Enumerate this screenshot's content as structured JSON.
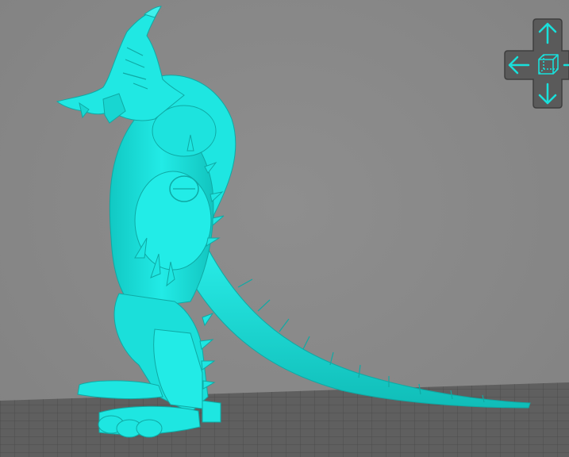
{
  "viewport": {
    "background_color": "#878787",
    "model_color": "#19e0db",
    "model_shadow_color": "#0fb5b0",
    "model_highlight_color": "#6ff5f1",
    "build_plate_color": "#5e5e5e",
    "build_plate_grid_color": "#4a4a4a"
  },
  "nav_cube": {
    "pad_color": "#5c5c5c",
    "pad_edge_color": "#3f3f3f",
    "arrow_color": "#19e0db",
    "icons": {
      "up": "arrow-up-icon",
      "down": "arrow-down-icon",
      "left": "arrow-left-icon",
      "right": "arrow-right-icon",
      "center": "cube-icon"
    }
  }
}
